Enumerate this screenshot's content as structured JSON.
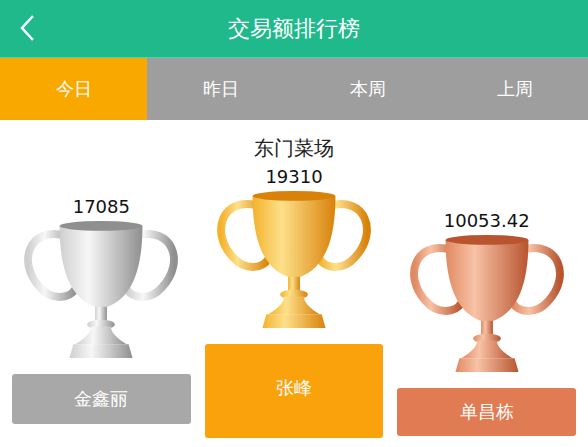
{
  "header": {
    "title": "交易额排行榜"
  },
  "tabs": [
    {
      "label": "今日",
      "selected": true
    },
    {
      "label": "昨日",
      "selected": false
    },
    {
      "label": "本周",
      "selected": false
    },
    {
      "label": "上周",
      "selected": false
    }
  ],
  "market": "东门菜场",
  "podium": [
    {
      "name": "金鑫丽",
      "amount": "17085",
      "kind": "silver",
      "color": "#a8a8a8"
    },
    {
      "name": "张峰",
      "amount": "19310",
      "kind": "gold",
      "color": "#f9a20c"
    },
    {
      "name": "单昌栋",
      "amount": "10053.42",
      "kind": "bronze",
      "color": "#e07b53"
    }
  ]
}
